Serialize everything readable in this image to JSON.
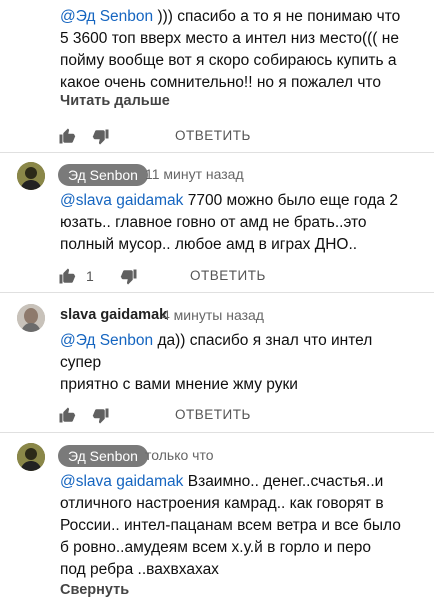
{
  "comment1": {
    "mention": "@Эд Senbon",
    "lines": [
      " ))) спасибо а то я не понимаю что",
      "5 3600 топ вверх место а интел низ место((( не",
      "пойму вообще вот я скоро собираюсь купить а",
      "какое очень сомнительно!! но я пожалел что"
    ],
    "read_more": "Читать дальше",
    "reply_label": "ОТВЕТИТЬ"
  },
  "comment2": {
    "author": "Эд Senbon",
    "time": "11 минут назад",
    "mention": "@slava gaidamak",
    "lines": [
      " 7700 можно было еще года 2",
      "юзать.. главное говно от амд не брать..это",
      "полный мусор.. любое амд в играх ДНО.."
    ],
    "likes": "1",
    "reply_label": "ОТВЕТИТЬ"
  },
  "comment3": {
    "author": "slava gaidamak",
    "time": "4 минуты назад",
    "mention": "@Эд Senbon",
    "lines": [
      "  да)) спасибо я знал что интел",
      "супер",
      "приятно с вами мнение жму руки"
    ],
    "reply_label": "ОТВЕТИТЬ"
  },
  "comment4": {
    "author": "Эд Senbon",
    "time": "только что",
    "mention": "@slava gaidamak",
    "lines": [
      " Взаимно..  денег..счастья..и",
      "отличного настроения камрад.. как говорят в",
      "России.. интел-пацанам всем ветра и все было",
      "б ровно..амудеям всем х.у.й в горло и перо",
      "под ребра ..вахвхахах"
    ],
    "collapse": "Свернуть"
  },
  "colors": {
    "mention": "#1565c0",
    "chip": "#7a7a7a",
    "divider": "#e0e0e0"
  },
  "icons": [
    "thumb-up-icon",
    "thumb-down-icon"
  ]
}
